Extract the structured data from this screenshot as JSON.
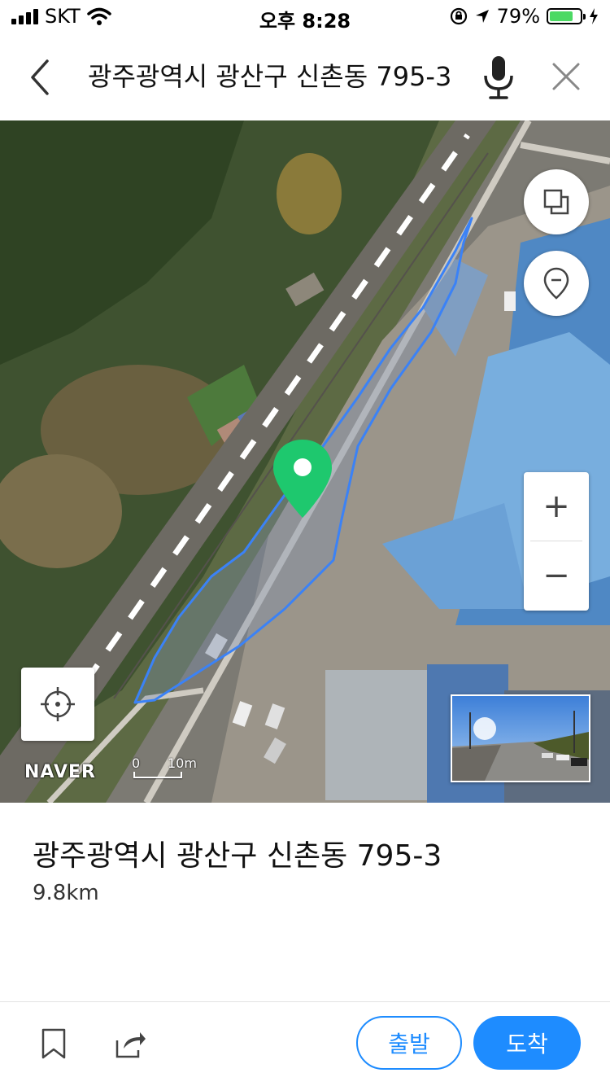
{
  "status_bar": {
    "carrier": "SKT",
    "time": "오후 8:28",
    "battery_percent": "79%",
    "battery_level": 0.79,
    "icons": [
      "signal-icon",
      "wifi-icon",
      "rotation-lock-icon",
      "location-arrow-icon",
      "battery-icon",
      "charging-bolt-icon"
    ]
  },
  "search": {
    "query": "광주광역시 광산구 신촌동 795-3",
    "icons": [
      "back-chevron-icon",
      "microphone-icon",
      "close-x-icon"
    ]
  },
  "map": {
    "logo": "NAVER",
    "scale": {
      "start": "0",
      "end": "10m"
    },
    "controls": {
      "zoom_in": "+",
      "zoom_out": "−",
      "icons": [
        "layers-icon",
        "pin-outline-icon",
        "crosshair-icon",
        "map-marker-icon"
      ]
    },
    "colors": {
      "route": "#3b82f6",
      "marker": "#1ec86e"
    }
  },
  "place": {
    "title": "광주광역시 광산구 신촌동 795-3",
    "distance": "9.8km"
  },
  "actions": {
    "origin_label": "출발",
    "destination_label": "도착",
    "icons": [
      "bookmark-icon",
      "share-icon"
    ]
  },
  "colors": {
    "accent": "#1e8cff"
  }
}
